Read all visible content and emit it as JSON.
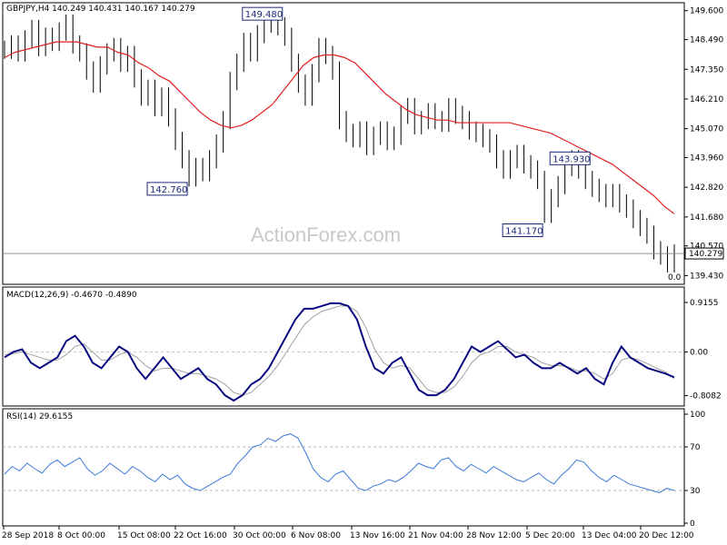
{
  "watermark": "ActionForex.com",
  "chart_data": [
    {
      "type": "line",
      "pane": "price",
      "title": "GBPJPY,H4  140.249 140.431 140.167 140.279",
      "series": [],
      "x_ticks": [
        "28 Sep 2018",
        "8 Oct 00:00",
        "15 Oct 08:00",
        "22 Oct 16:00",
        "30 Oct 00:00",
        "6 Nov 08:00",
        "13 Nov 16:00",
        "21 Nov 04:00",
        "28 Nov 12:00",
        "5 Dec 20:00",
        "13 Dec 04:00",
        "20 Dec 12:00"
      ],
      "y_ticks": [
        "149.600",
        "148.490",
        "147.350",
        "146.210",
        "145.070",
        "143.960",
        "142.820",
        "141.680",
        "140.570",
        "139.430"
      ],
      "ylim": [
        139.2,
        149.8
      ],
      "close_prices": [
        148.1,
        148.3,
        148.0,
        148.5,
        148.9,
        148.2,
        148.6,
        148.4,
        148.8,
        149.1,
        148.3,
        148.0,
        147.3,
        146.8,
        147.5,
        148.0,
        148.2,
        147.6,
        147.9,
        147.0,
        146.3,
        146.6,
        145.9,
        146.3,
        145.5,
        144.6,
        143.9,
        143.2,
        143.6,
        143.4,
        143.9,
        144.5,
        145.4,
        146.9,
        147.6,
        148.4,
        148.0,
        148.7,
        149.1,
        149.3,
        149.0,
        148.6,
        147.6,
        146.8,
        146.3,
        147.2,
        148.2,
        147.9,
        147.3,
        145.4,
        144.9,
        144.7,
        145.0,
        144.4,
        144.8,
        145.0,
        144.6,
        144.8,
        145.6,
        145.9,
        145.2,
        145.4,
        145.7,
        145.4,
        145.3,
        145.9,
        145.6,
        145.4,
        145.0,
        144.9,
        144.7,
        144.5,
        143.9,
        143.5,
        143.9,
        144.1,
        143.7,
        143.5,
        143.1,
        141.8,
        142.4,
        142.9,
        143.6,
        143.9,
        143.5,
        143.1,
        142.8,
        142.6,
        142.4,
        142.6,
        142.2,
        142.0,
        141.6,
        141.3,
        141.0,
        140.4,
        140.2,
        139.9,
        140.279
      ],
      "ma_label": "MA",
      "ma_values": [
        147.8,
        148.0,
        148.1,
        148.2,
        148.3,
        148.4,
        148.4,
        148.4,
        148.3,
        148.2,
        148.2,
        148.0,
        147.9,
        147.6,
        147.4,
        147.1,
        146.9,
        146.5,
        146.1,
        145.7,
        145.4,
        145.2,
        145.1,
        145.2,
        145.4,
        145.7,
        146.0,
        146.5,
        147.0,
        147.5,
        147.8,
        147.9,
        147.9,
        147.8,
        147.6,
        147.2,
        146.8,
        146.4,
        146.1,
        145.8,
        145.6,
        145.5,
        145.4,
        145.4,
        145.3,
        145.3,
        145.3,
        145.3,
        145.3,
        145.3,
        145.2,
        145.1,
        145.0,
        144.9,
        144.7,
        144.5,
        144.3,
        144.1,
        143.9,
        143.7,
        143.4,
        143.1,
        142.8,
        142.5,
        142.1,
        141.8
      ],
      "annotations": [
        {
          "label": "149.480",
          "value": 149.48
        },
        {
          "label": "142.760",
          "value": 142.76
        },
        {
          "label": "143.930",
          "value": 143.93
        },
        {
          "label": "141.170",
          "value": 141.17
        }
      ],
      "last_price": {
        "label": "140.279",
        "value": 140.279
      },
      "corner_label": "0.0",
      "colors": {
        "price": "#000000",
        "ma": "#e02020",
        "last_line": "#808080"
      }
    },
    {
      "type": "line",
      "pane": "macd",
      "title": "MACD(12,26,9) -0.4670 -0.4890",
      "y_ticks": [
        "0.9155",
        "0.00",
        "-0.8082"
      ],
      "ylim": [
        -0.95,
        1.05
      ],
      "macd_values": [
        -0.1,
        0.0,
        0.05,
        -0.2,
        -0.3,
        -0.2,
        -0.1,
        0.2,
        0.3,
        0.1,
        -0.2,
        -0.3,
        -0.1,
        0.1,
        0.0,
        -0.3,
        -0.5,
        -0.3,
        -0.1,
        -0.3,
        -0.5,
        -0.4,
        -0.3,
        -0.5,
        -0.6,
        -0.8,
        -0.9,
        -0.8,
        -0.6,
        -0.5,
        -0.3,
        0.0,
        0.3,
        0.6,
        0.8,
        0.8,
        0.85,
        0.9,
        0.9,
        0.85,
        0.6,
        0.1,
        -0.3,
        -0.4,
        -0.2,
        -0.1,
        -0.4,
        -0.7,
        -0.8,
        -0.8,
        -0.7,
        -0.5,
        -0.2,
        0.1,
        0.0,
        0.1,
        0.2,
        0.05,
        -0.1,
        -0.05,
        -0.2,
        -0.3,
        -0.3,
        -0.2,
        -0.3,
        -0.4,
        -0.3,
        -0.5,
        -0.6,
        -0.2,
        0.1,
        -0.1,
        -0.2,
        -0.3,
        -0.35,
        -0.4,
        -0.47
      ],
      "signal_values": [
        -0.05,
        -0.03,
        0.0,
        -0.05,
        -0.1,
        -0.15,
        -0.15,
        -0.05,
        0.1,
        0.15,
        0.0,
        -0.15,
        -0.15,
        -0.05,
        0.0,
        -0.1,
        -0.25,
        -0.35,
        -0.3,
        -0.3,
        -0.35,
        -0.4,
        -0.4,
        -0.45,
        -0.5,
        -0.6,
        -0.75,
        -0.8,
        -0.75,
        -0.6,
        -0.45,
        -0.25,
        0.0,
        0.25,
        0.5,
        0.65,
        0.75,
        0.8,
        0.85,
        0.85,
        0.75,
        0.45,
        0.05,
        -0.2,
        -0.3,
        -0.25,
        -0.3,
        -0.5,
        -0.7,
        -0.75,
        -0.75,
        -0.65,
        -0.45,
        -0.2,
        -0.05,
        0.0,
        0.1,
        0.1,
        0.0,
        -0.05,
        -0.1,
        -0.2,
        -0.25,
        -0.25,
        -0.28,
        -0.35,
        -0.35,
        -0.4,
        -0.5,
        -0.4,
        -0.15,
        -0.1,
        -0.15,
        -0.22,
        -0.3,
        -0.37,
        -0.49
      ],
      "colors": {
        "macd": "#0a0a80",
        "signal": "#a0a0a0"
      }
    },
    {
      "type": "line",
      "pane": "rsi",
      "title": "RSI(14) 29.6155",
      "y_ticks": [
        "100",
        "70",
        "30",
        "0"
      ],
      "ylim": [
        0,
        100
      ],
      "levels": [
        70,
        30
      ],
      "rsi_values": [
        45,
        52,
        48,
        55,
        50,
        46,
        54,
        58,
        52,
        56,
        60,
        50,
        44,
        48,
        55,
        50,
        45,
        52,
        48,
        42,
        38,
        45,
        40,
        44,
        36,
        32,
        30,
        34,
        38,
        42,
        45,
        55,
        62,
        70,
        72,
        78,
        75,
        80,
        82,
        78,
        65,
        50,
        42,
        38,
        45,
        48,
        40,
        32,
        30,
        34,
        36,
        40,
        38,
        42,
        48,
        55,
        52,
        50,
        58,
        60,
        52,
        48,
        54,
        50,
        46,
        52,
        48,
        44,
        40,
        38,
        42,
        46,
        40,
        36,
        44,
        50,
        58,
        56,
        48,
        42,
        38,
        44,
        40,
        36,
        34,
        32,
        30,
        28,
        32,
        30
      ],
      "colors": {
        "rsi": "#3a7ad8",
        "levels": "#a0a0a0"
      }
    }
  ]
}
